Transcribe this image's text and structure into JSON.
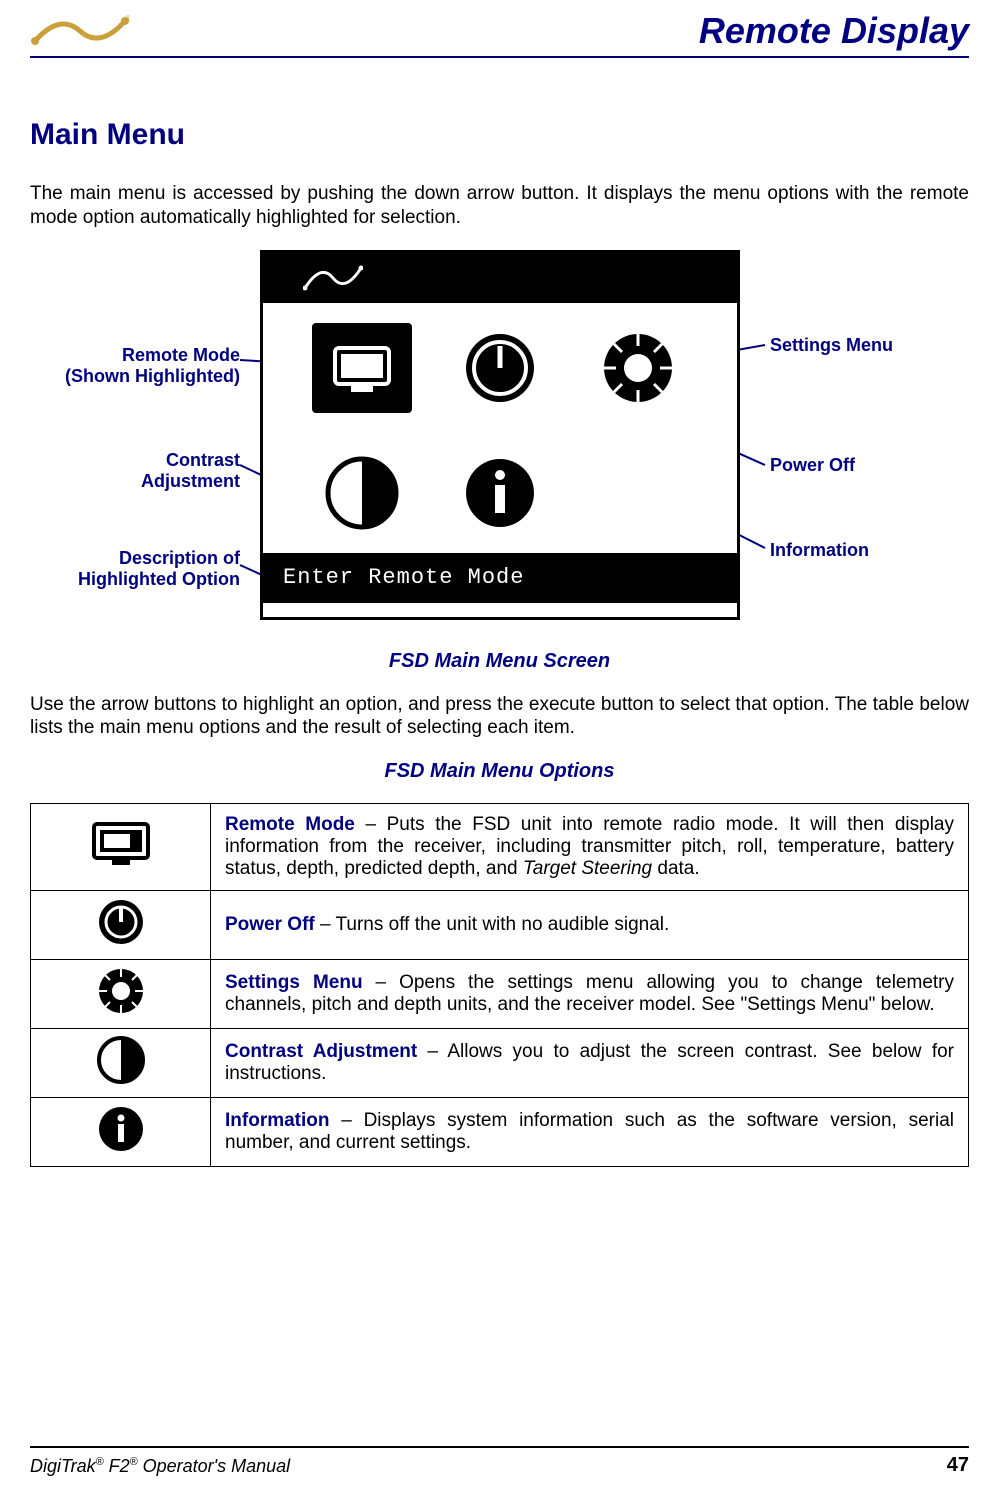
{
  "header": {
    "title": "Remote Display"
  },
  "main": {
    "heading": "Main Menu",
    "intro": "The main menu is accessed by pushing the down arrow button. It displays the menu options with the remote mode option automatically highlighted for selection."
  },
  "diagram": {
    "callouts": {
      "remote_mode_l1": "Remote Mode",
      "remote_mode_l2": "(Shown Highlighted)",
      "contrast_l1": "Contrast",
      "contrast_l2": "Adjustment",
      "description_l1": "Description of",
      "description_l2": "Highlighted Option",
      "settings": "Settings Menu",
      "power_off": "Power Off",
      "information": "Information"
    },
    "screen_footer": "Enter Remote Mode",
    "caption": "FSD Main Menu Screen"
  },
  "body2": "Use the arrow buttons to highlight an option, and press the execute button to select that option. The table below lists the main menu options and the result of selecting each item.",
  "table_caption": "FSD Main Menu Options",
  "table": [
    {
      "label": "Remote Mode",
      "desc": " – Puts the FSD unit into remote radio mode. It will then display information from the receiver, including transmitter pitch, roll, temperature, battery status, depth, predicted depth, and ",
      "ital": "Target Steering",
      "desc2": " data."
    },
    {
      "label": "Power Off",
      "desc": " – Turns off the unit with no audible signal.",
      "ital": "",
      "desc2": ""
    },
    {
      "label": "Settings Menu",
      "desc": " – Opens the settings menu allowing you to change telemetry channels, pitch and depth units, and the receiver model. See \"Settings Menu\" below.",
      "ital": "",
      "desc2": ""
    },
    {
      "label": "Contrast Adjustment",
      "desc": " – Allows you to adjust the screen contrast. See below for instructions.",
      "ital": "",
      "desc2": ""
    },
    {
      "label": "Information",
      "desc": " – Displays system information such as the software version, serial number, and current settings.",
      "ital": "",
      "desc2": ""
    }
  ],
  "footer": {
    "manual_prefix": "DigiTrak",
    "manual_mid": " F2",
    "manual_suffix": " Operator's Manual",
    "page": "47"
  }
}
